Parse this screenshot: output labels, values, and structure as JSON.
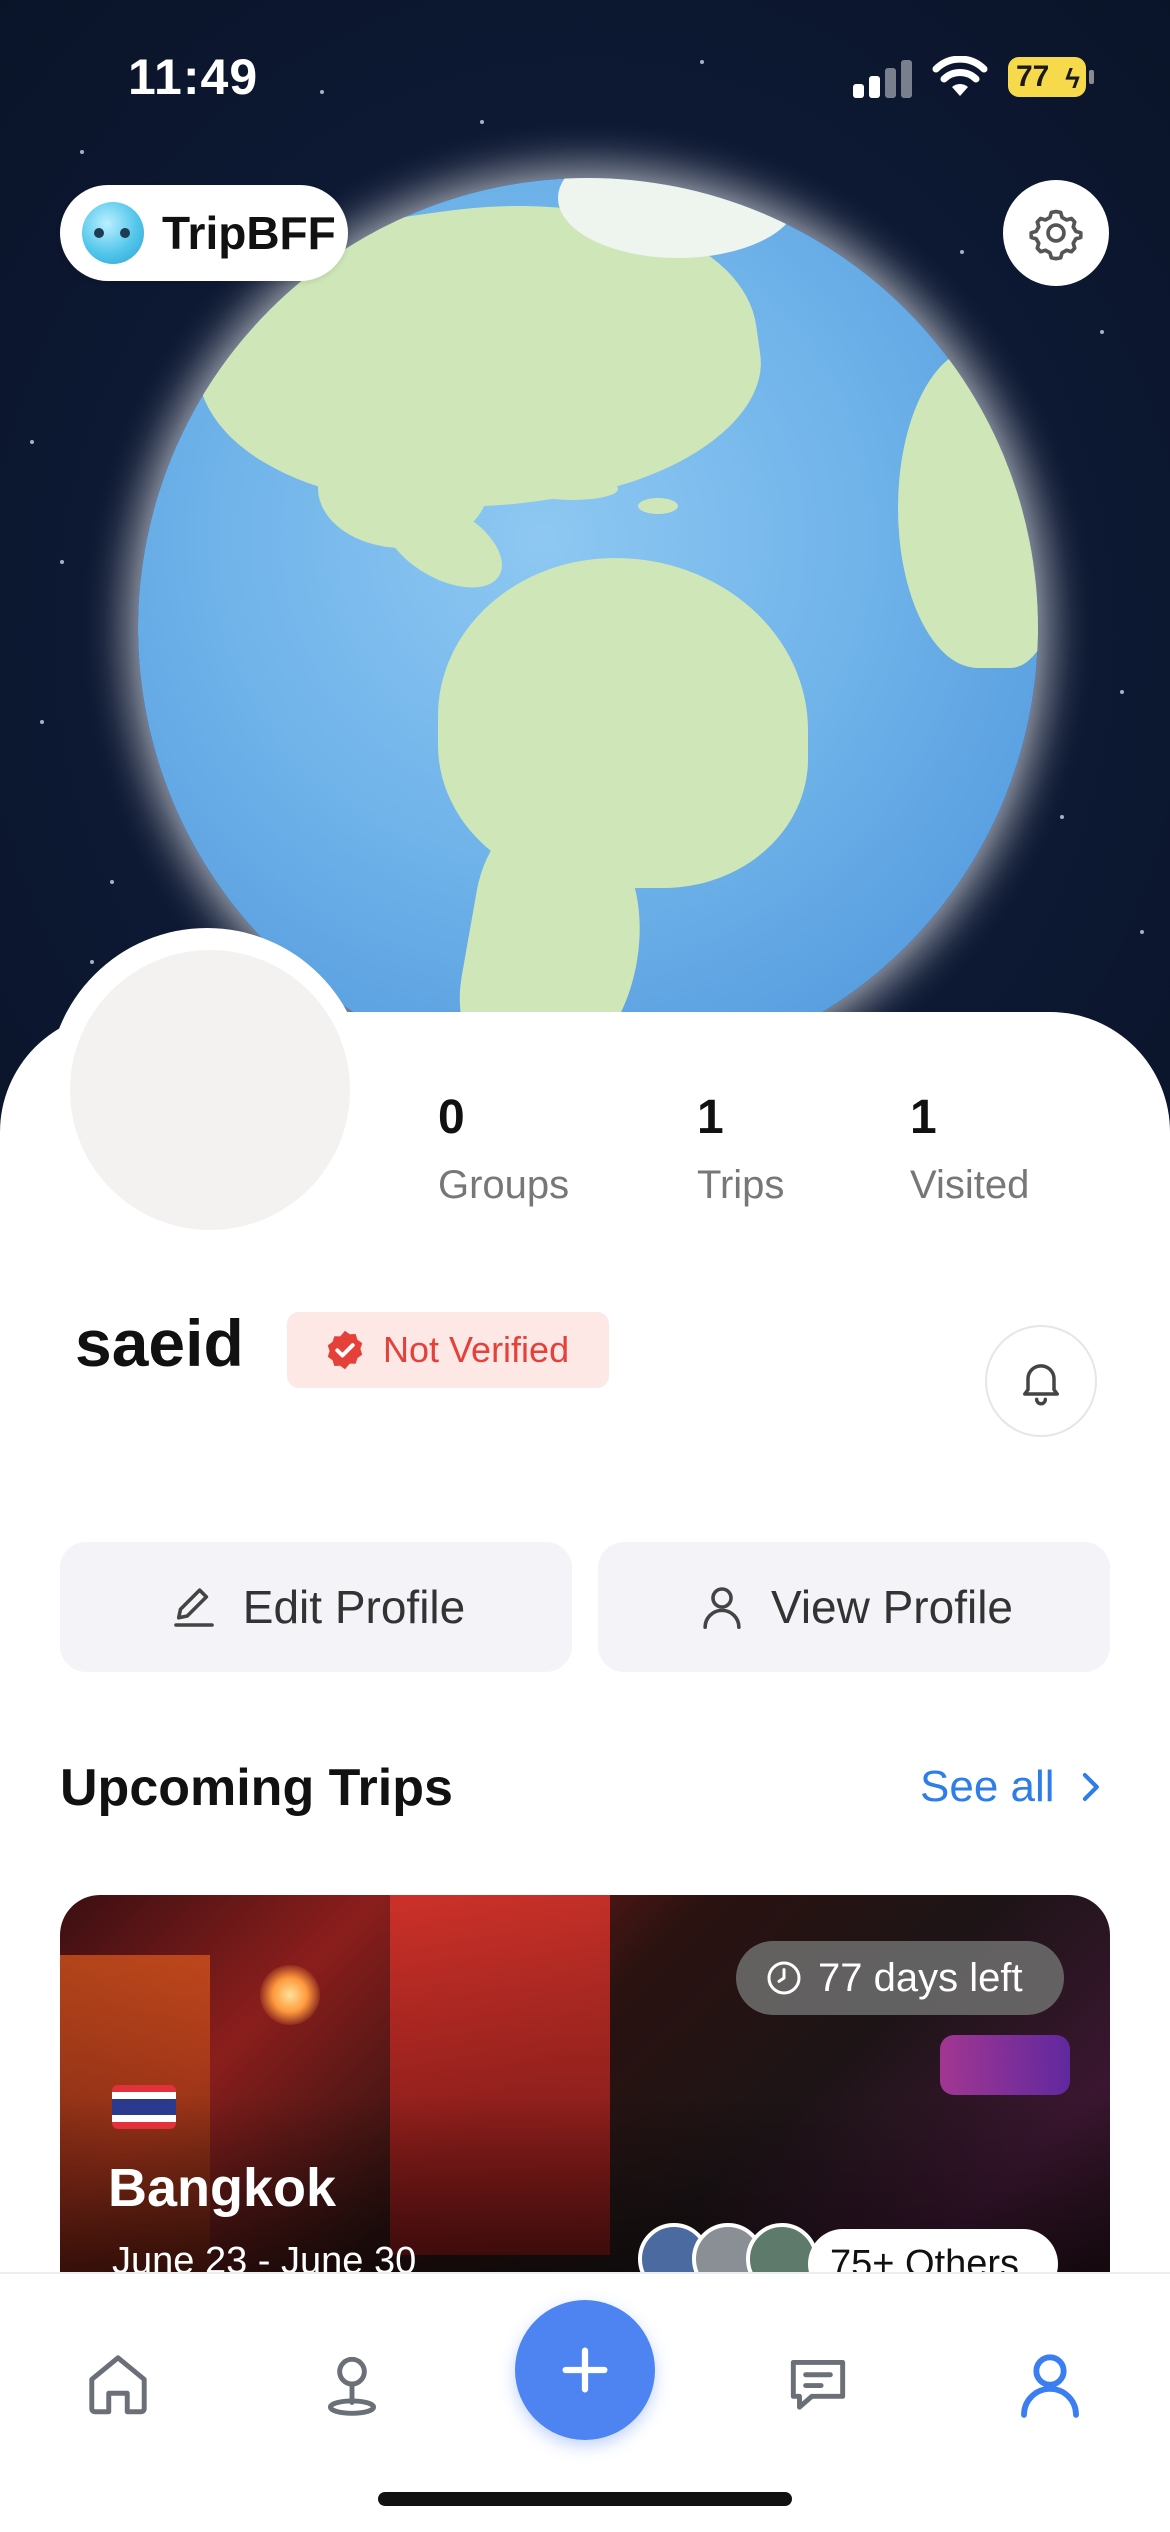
{
  "status_bar": {
    "time": "11:49",
    "battery": "77"
  },
  "brand": {
    "name": "TripBFF"
  },
  "icons": {
    "settings": "gear-icon",
    "bell": "bell-icon",
    "edit": "pencil-icon",
    "person": "person-icon",
    "clock": "clock-icon",
    "chevron": "chevron-right-icon",
    "home": "home-icon",
    "map": "map-pin-icon",
    "add": "plus-icon",
    "chat": "chat-icon",
    "profile": "profile-icon"
  },
  "stats": [
    {
      "value": "0",
      "label": "Groups"
    },
    {
      "value": "1",
      "label": "Trips"
    },
    {
      "value": "1",
      "label": "Visited"
    }
  ],
  "user": {
    "name": "saeid",
    "verification": "Not Verified"
  },
  "actions": {
    "edit": "Edit Profile",
    "view": "View Profile"
  },
  "upcoming": {
    "title": "Upcoming Trips",
    "see_all": "See all",
    "trip": {
      "days_left": "77 days left",
      "city": "Bangkok",
      "dates": "June 23 - June 30",
      "others": "75+ Others"
    }
  },
  "colors": {
    "accent": "#2f7de8",
    "fab": "#4d84f2",
    "badge_bg": "#fde8e6",
    "badge_text": "#e5413a",
    "active_tab": "#3b7ef2"
  }
}
